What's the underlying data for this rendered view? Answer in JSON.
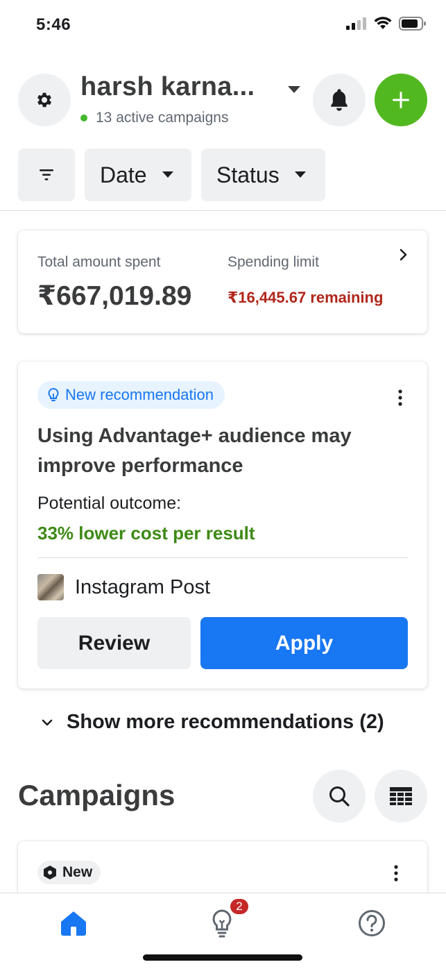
{
  "status_bar": {
    "time": "5:46"
  },
  "header": {
    "account_name": "harsh karna...",
    "active_campaigns": "13 active campaigns",
    "icons": [
      "gear-icon",
      "caret-down-icon",
      "bell-icon",
      "plus-icon"
    ],
    "add_button_color": "#52b820"
  },
  "filters": {
    "date_label": "Date",
    "status_label": "Status"
  },
  "spending": {
    "total_label": "Total amount spent",
    "total_value": "₹667,019.89",
    "limit_label": "Spending limit",
    "remaining": "₹16,445.67 remaining",
    "remaining_color": "#b0261a"
  },
  "recommendation": {
    "badge": "New recommendation",
    "title": "Using Advantage+ audience may improve performance",
    "outcome_label": "Potential outcome:",
    "outcome_value": "33% lower cost per result",
    "outcome_color": "#3e8a16",
    "post_label": "Instagram Post",
    "review_label": "Review",
    "apply_label": "Apply",
    "apply_color": "#1877f2"
  },
  "show_more": "Show more recommendations (2)",
  "campaigns": {
    "title": "Campaigns",
    "first_card_badge": "New"
  },
  "bottom_nav": {
    "items": [
      "home-icon",
      "lightbulb-icon",
      "help-icon"
    ],
    "recs_badge": "2"
  }
}
